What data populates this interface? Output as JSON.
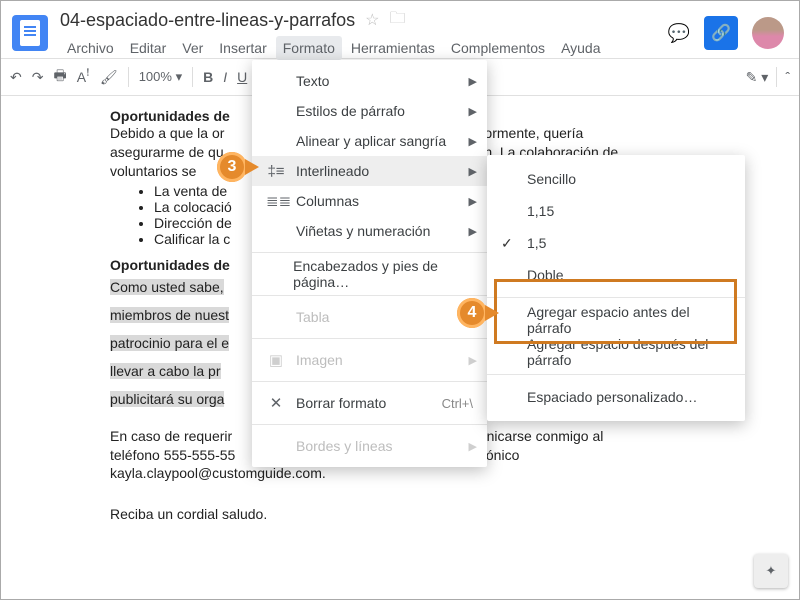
{
  "header": {
    "doc_title": "04-espaciado-entre-lineas-y-parrafos",
    "menubar": [
      "Archivo",
      "Editar",
      "Ver",
      "Insertar",
      "Formato",
      "Herramientas",
      "Complementos",
      "Ayuda"
    ],
    "active_menu_index": 4
  },
  "toolbar": {
    "zoom": "100%",
    "bold": "B",
    "italic": "I",
    "underline": "U",
    "color": "A",
    "more": "…"
  },
  "document": {
    "h1": "Oportunidades de ",
    "p1a": "Debido a que la or",
    "p1b": "ormente, quería",
    "p2a": "asegurarme de qu",
    "p2b": "ación. La colaboración de",
    "p3": "voluntarios se",
    "bullets": [
      "La venta de",
      "La colocació",
      "Dirección de",
      "Calificar la c"
    ],
    "h2": "Oportunidades de ",
    "sp1": "Como usted sabe,",
    "sp2": "miembros de nuest",
    "sp3": "patrocinio para el e",
    "sp4": "llevar a cabo la pr",
    "sp5": "publicitará su orga",
    "f1a": "En caso de requerir",
    "f1b": "municarse conmigo al",
    "f2a": "teléfono 555-555-55",
    "f2b": "ctrónico",
    "f3": "kayla.claypool@customguide.com.",
    "closing": "Reciba un cordial saludo."
  },
  "format_menu": {
    "text": "Texto",
    "paragraph_styles": "Estilos de párrafo",
    "align": "Alinear y aplicar sangría",
    "line_spacing": "Interlineado",
    "columns": "Columnas",
    "bullets": "Viñetas y numeración",
    "headers": "Encabezados y pies de página…",
    "table": "Tabla",
    "image": "Imagen",
    "clear": "Borrar formato",
    "clear_shortcut": "Ctrl+\\",
    "borders": "Bordes y líneas"
  },
  "spacing_menu": {
    "single": "Sencillo",
    "v115": "1,15",
    "v15": "1,5",
    "double": "Doble",
    "add_before": "Agregar espacio antes del párrafo",
    "add_after": "Agregar espacio después del párrafo",
    "custom": "Espaciado personalizado…",
    "selected": "v15"
  },
  "callouts": {
    "c3": "3",
    "c4": "4"
  }
}
